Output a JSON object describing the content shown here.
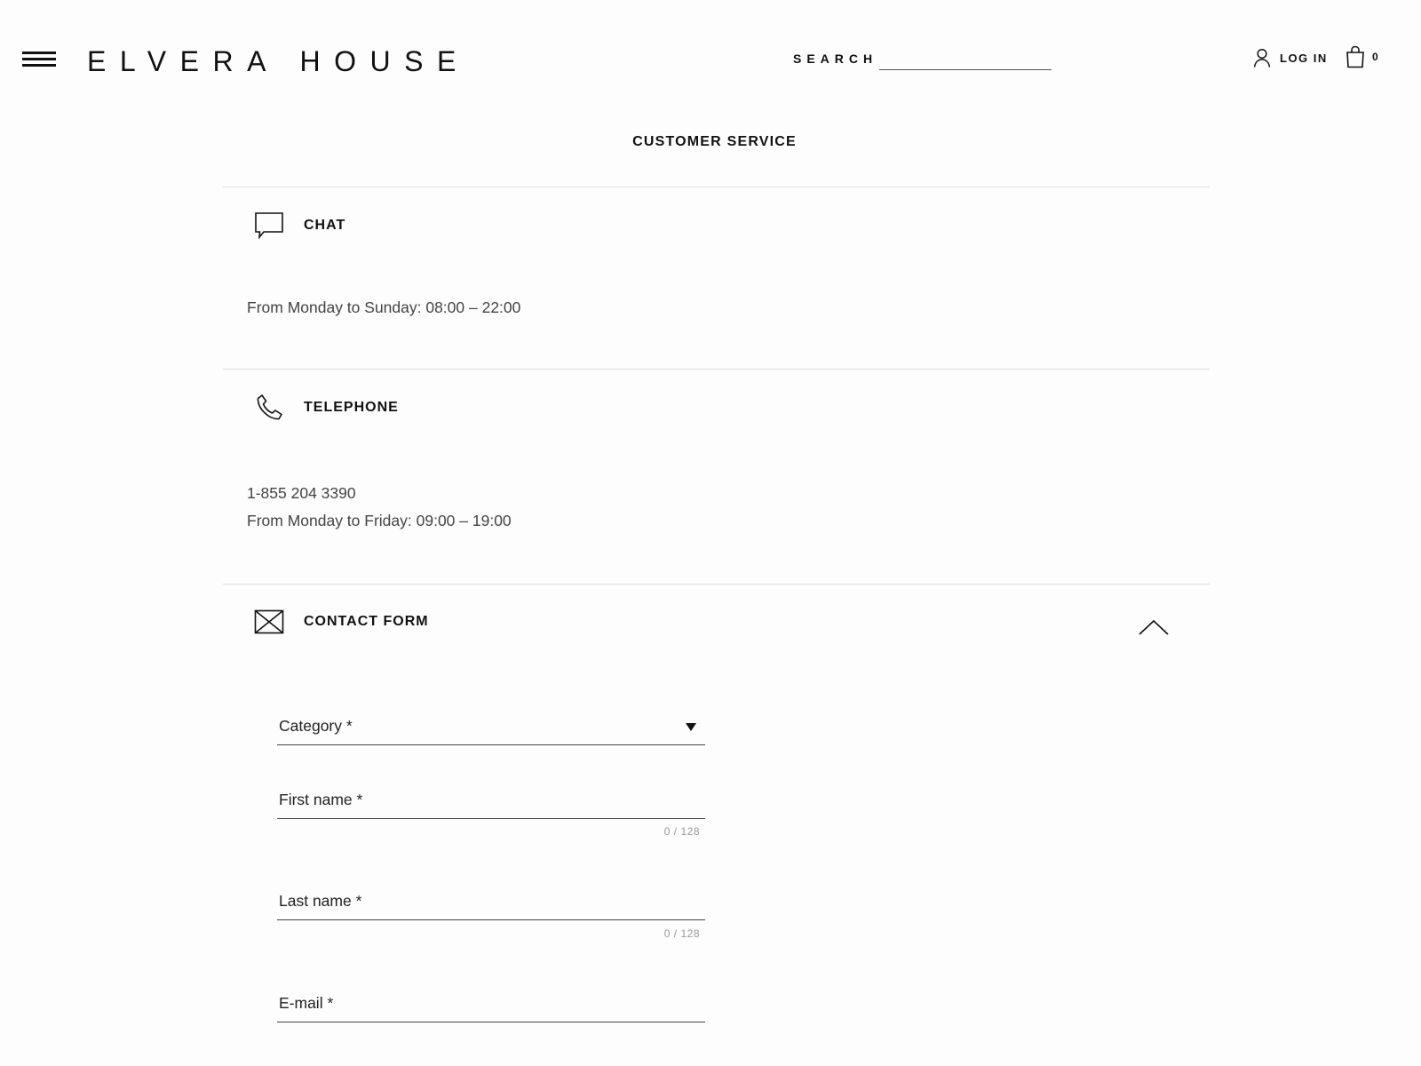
{
  "brand": {
    "logo": "ELVERA HOUSE"
  },
  "header": {
    "search_label": "SEARCH",
    "search_value": "",
    "login_label": "LOG IN",
    "cart_count": "0"
  },
  "page": {
    "title": "CUSTOMER SERVICE"
  },
  "sections": {
    "chat": {
      "label": "CHAT",
      "icon": "chat-bubble-icon",
      "lines": [
        "From Monday to Sunday: 08:00 – 22:00"
      ]
    },
    "telephone": {
      "label": "TELEPHONE",
      "icon": "phone-icon",
      "lines": [
        "1-855 204 3390",
        "From Monday to Friday: 09:00 – 19:00"
      ]
    },
    "contact_form": {
      "label": "CONTACT FORM",
      "icon": "envelope-icon",
      "expanded": true,
      "fields": {
        "category": {
          "label": "Category *",
          "value": ""
        },
        "first_name": {
          "label": "First name *",
          "value": "",
          "counter": "0 / 128"
        },
        "last_name": {
          "label": "Last name *",
          "value": "",
          "counter": "0 / 128"
        },
        "email": {
          "label": "E-mail *",
          "value": ""
        }
      }
    }
  },
  "colors": {
    "text": "#111111",
    "muted_text": "#444444",
    "divider": "#dcdcdc",
    "background": "#fdfdfd"
  }
}
